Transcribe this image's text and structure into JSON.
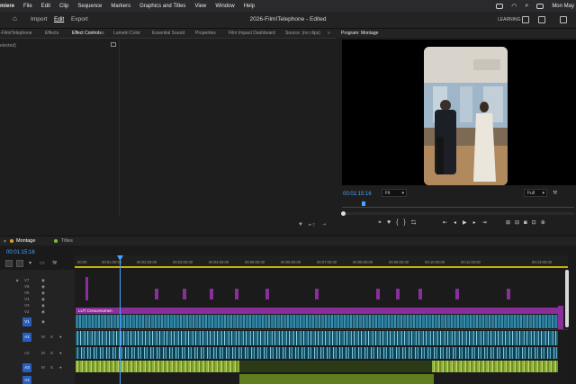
{
  "menubar": {
    "app": "miere",
    "items": [
      "File",
      "Edit",
      "Clip",
      "Sequence",
      "Markers",
      "Graphics and Titles",
      "View",
      "Window",
      "Help"
    ],
    "clock": "Mon May"
  },
  "header": {
    "nav": [
      "Import",
      "Edit",
      "Export"
    ],
    "active_nav": "Edit",
    "title": "2026-FilmITelephone - Edited",
    "workspace": "LEARNING"
  },
  "panel_tabs": [
    "-FilmITelephone",
    "Effects",
    "Effect Controls",
    "Lumetri Color",
    "Essential Sound",
    "Properties",
    "Film Impact Dashboard",
    "Source: (no clips)"
  ],
  "active_tab": "Effect Controls",
  "effect_controls": {
    "selection_text": "elected)"
  },
  "program": {
    "tab_label": "Program: Montage",
    "timecode": "00:01:15:16",
    "fit_value": "Fit",
    "quality_value": "Full"
  },
  "timeline": {
    "tabs": [
      "Montage",
      "Titles"
    ],
    "timecode": "00:01:15:16",
    "ruler_labels": [
      "00:00",
      "00:01:00:00",
      "00:02:00:00",
      "00:03:00:00",
      "00:04:00:00",
      "00:05:00:00",
      "00:06:00:00",
      "00:07:00:00",
      "00:08:00:00",
      "00:09:00:00",
      "00:10:00:00",
      "00:11:00:00",
      "00:13:00:00"
    ],
    "video_tracks": [
      "V7",
      "V6",
      "V5",
      "V4",
      "V3",
      "V2",
      "V1"
    ],
    "audio_tracks": [
      "A1",
      "A2",
      "A3",
      "A4"
    ],
    "lut_clip_label": "LUT Crescenomen"
  },
  "colors": {
    "accent": "#4aa3ff",
    "clip_magenta": "#8a2f9a",
    "clip_video": "#1f5f77",
    "clip_audio_green": "#7a9a2a",
    "badge_blue": "#2b5fbf"
  }
}
